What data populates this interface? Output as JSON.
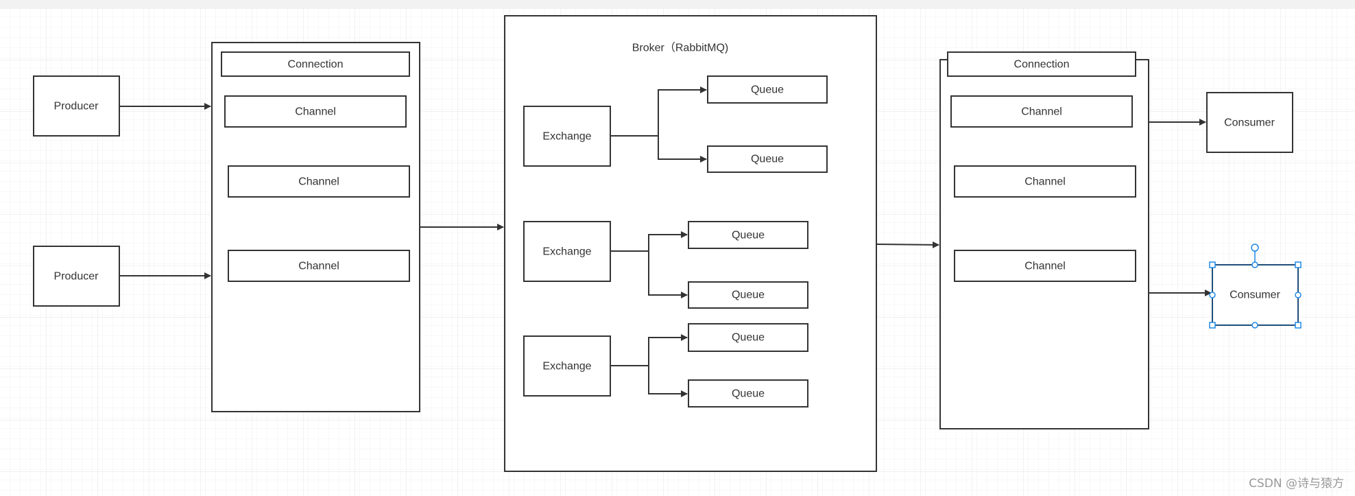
{
  "broker": {
    "title": "Broker（RabbitMQ)"
  },
  "producers": [
    "Producer",
    "Producer"
  ],
  "left_connection": {
    "label": "Connection",
    "channels": [
      "Channel",
      "Channel",
      "Channel"
    ]
  },
  "exchanges": [
    "Exchange",
    "Exchange",
    "Exchange"
  ],
  "queues": [
    "Queue",
    "Queue",
    "Queue",
    "Queue",
    "Queue",
    "Queue"
  ],
  "right_connection": {
    "label": "Connection",
    "channels": [
      "Channel",
      "Channel",
      "Channel"
    ]
  },
  "consumers": [
    "Consumer",
    "Consumer"
  ],
  "selected_shape": "consumer-2",
  "colors": {
    "stroke": "#333333",
    "selection": "#1e88e5",
    "grid": "#ebebeb"
  },
  "watermark": "CSDN @诗与猿方"
}
